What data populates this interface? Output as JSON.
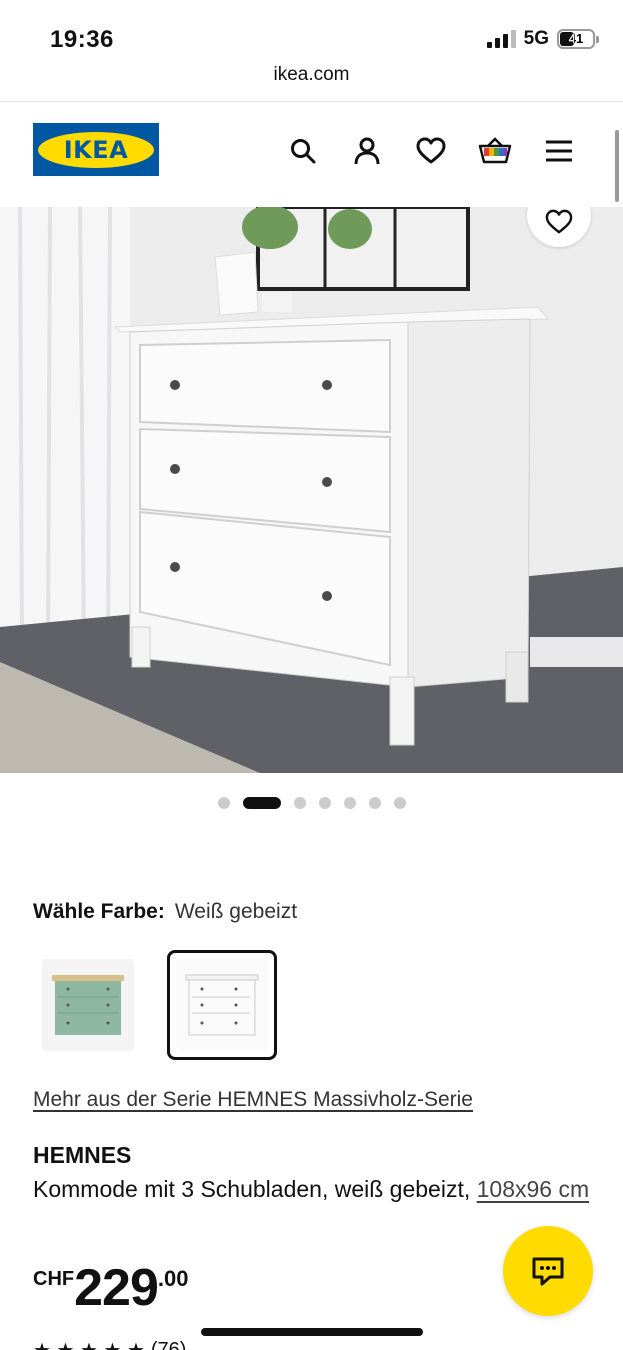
{
  "status_bar": {
    "time": "19:36",
    "network": "5G",
    "battery": "41"
  },
  "browser": {
    "url": "ikea.com"
  },
  "header": {
    "logo_text": "IKEA",
    "logo_color": "#0058a3",
    "logo_accent": "#ffdb00"
  },
  "gallery": {
    "image_count": 7,
    "active_index": 1
  },
  "product": {
    "color_label": "Wähle Farbe:",
    "color_value": "Weiß gebeizt",
    "swatches": [
      {
        "name": "grün",
        "color": "#8fb8a2",
        "selected": false
      },
      {
        "name": "weiß gebeizt",
        "color": "#f2f2ee",
        "selected": true
      }
    ],
    "series_link": "Mehr aus der Serie HEMNES Massivholz-Serie",
    "name": "HEMNES",
    "description": "Kommode mit 3 Schubladen, weiß gebeizt, ",
    "size": "108x96 cm",
    "price_currency": "CHF",
    "price_main": "229",
    "price_decimal": ".00",
    "rating_count": "(76)"
  }
}
